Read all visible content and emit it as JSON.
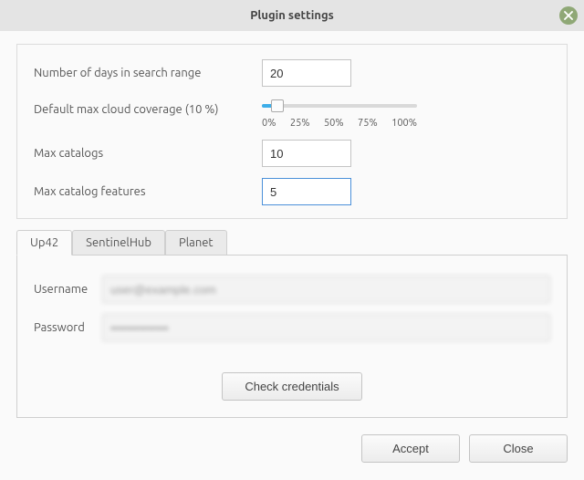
{
  "window": {
    "title": "Plugin settings"
  },
  "settings": {
    "days_range": {
      "label": "Number of days in search range",
      "value": "20"
    },
    "cloud": {
      "label": "Default max cloud coverage (10 %)",
      "percent": 10,
      "ticks": [
        "0%",
        "25%",
        "50%",
        "75%",
        "100%"
      ]
    },
    "max_catalogs": {
      "label": "Max catalogs",
      "value": "10"
    },
    "max_features": {
      "label": "Max catalog features",
      "value": "5"
    }
  },
  "tabs": [
    {
      "label": "Up42",
      "active": true
    },
    {
      "label": "SentinelHub",
      "active": false
    },
    {
      "label": "Planet",
      "active": false
    }
  ],
  "credentials": {
    "username_label": "Username",
    "password_label": "Password",
    "username_value": "user@example.com",
    "password_value": "••••••••••••••",
    "check_label": "Check credentials"
  },
  "footer": {
    "accept_label": "Accept",
    "close_label": "Close"
  }
}
